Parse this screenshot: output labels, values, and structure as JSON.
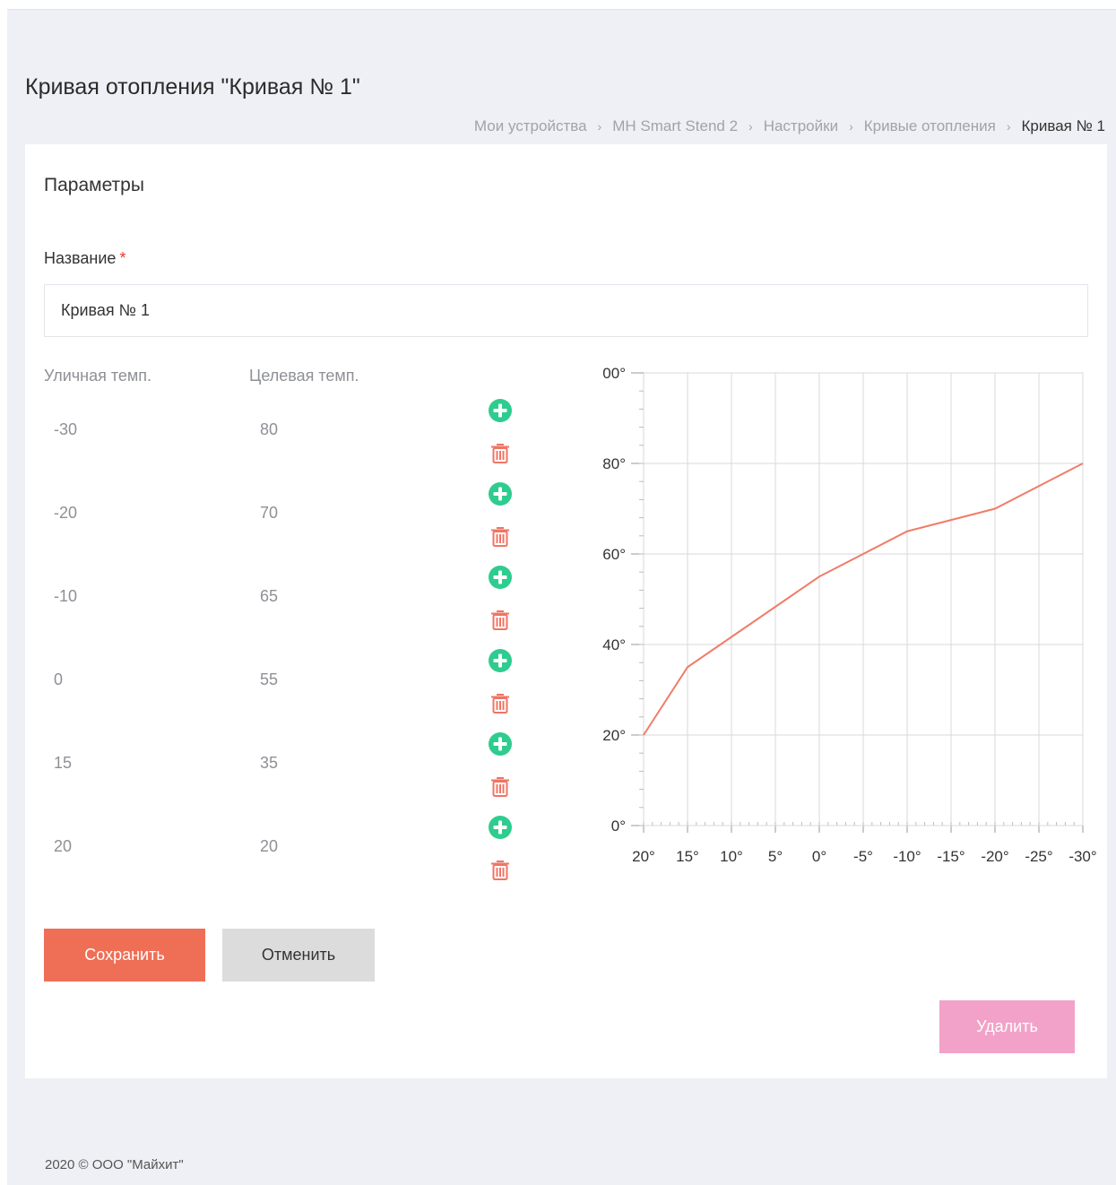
{
  "header": {
    "title": "Кривая отопления \"Кривая № 1\""
  },
  "breadcrumb": [
    {
      "label": "Мои устройства"
    },
    {
      "label": "MH Smart Stend 2"
    },
    {
      "label": "Настройки"
    },
    {
      "label": "Кривые отопления"
    },
    {
      "label": "Кривая № 1"
    }
  ],
  "card": {
    "title": "Параметры",
    "name_label": "Название",
    "required_mark": "*",
    "name_value": "Кривая № 1"
  },
  "table": {
    "col_outdoor": "Уличная темп.",
    "col_target": "Целевая темп.",
    "rows": [
      {
        "outdoor": "-30",
        "target": "80"
      },
      {
        "outdoor": "-20",
        "target": "70"
      },
      {
        "outdoor": "-10",
        "target": "65"
      },
      {
        "outdoor": "0",
        "target": "55"
      },
      {
        "outdoor": "15",
        "target": "35"
      },
      {
        "outdoor": "20",
        "target": "20"
      }
    ]
  },
  "icons": {
    "add": "plus-circle-icon",
    "delete": "trash-icon"
  },
  "colors": {
    "accent": "#ef6f56",
    "add_icon": "#2ecc8f",
    "delete_icon": "#f07464",
    "delete_button": "#f2a2c8",
    "line": "#ef7d69"
  },
  "buttons": {
    "save": "Сохранить",
    "cancel": "Отменить",
    "delete": "Удалить"
  },
  "chart_data": {
    "type": "line",
    "x": [
      20,
      15,
      0,
      -10,
      -20,
      -30
    ],
    "y": [
      20,
      35,
      55,
      65,
      70,
      80
    ],
    "xlim": [
      20,
      -30
    ],
    "ylim": [
      0,
      100
    ],
    "x_ticks": [
      "20°",
      "15°",
      "10°",
      "5°",
      "0°",
      "-5°",
      "-10°",
      "-15°",
      "-20°",
      "-25°",
      "-30°"
    ],
    "y_ticks": [
      "0°",
      "20°",
      "40°",
      "60°",
      "80°",
      "00°"
    ],
    "grid": true,
    "reversed_x": true
  },
  "footer": {
    "copyright": "2020 © ООО \"Майхит\""
  }
}
